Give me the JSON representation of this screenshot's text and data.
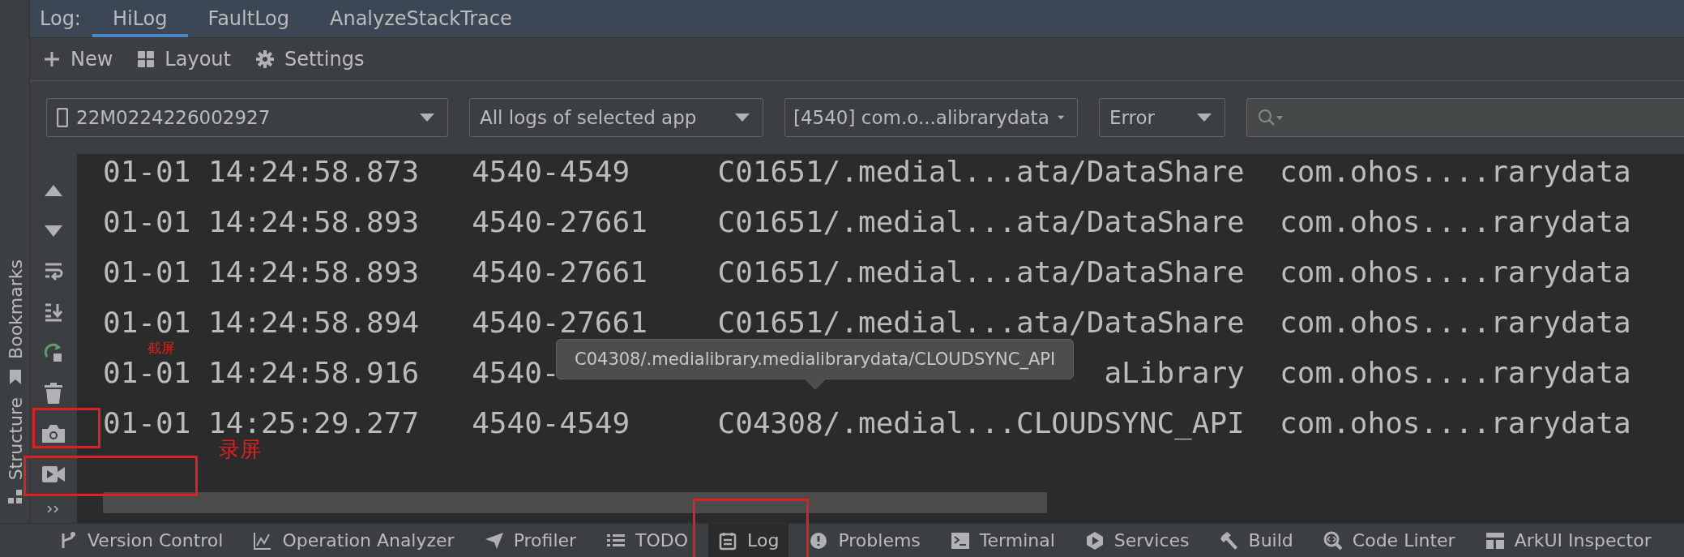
{
  "log_tabs": {
    "label": "Log:",
    "tabs": [
      {
        "label": "HiLog",
        "selected": true
      },
      {
        "label": "FaultLog",
        "selected": false
      },
      {
        "label": "AnalyzeStackTrace",
        "selected": false
      }
    ]
  },
  "toolbar": [
    {
      "label": "New"
    },
    {
      "label": "Layout"
    },
    {
      "label": "Settings"
    }
  ],
  "filters": {
    "device": "22M0224226002927",
    "scope": "All logs of selected app",
    "process": "[4540] com.o...alibrarydata",
    "level": "Error"
  },
  "side_strip": [
    {
      "label": "Bookmarks"
    },
    {
      "label": "Structure"
    }
  ],
  "log_rows": [
    {
      "time": "01-01 14:24:58.873",
      "pid": "4540-4549",
      "tag": "C01651/.medial...ata/DataShare",
      "package": "com.ohos....rarydata"
    },
    {
      "time": "01-01 14:24:58.893",
      "pid": "4540-27661",
      "tag": "C01651/.medial...ata/DataShare",
      "package": "com.ohos....rarydata"
    },
    {
      "time": "01-01 14:24:58.893",
      "pid": "4540-27661",
      "tag": "C01651/.medial...ata/DataShare",
      "package": "com.ohos....rarydata"
    },
    {
      "time": "01-01 14:24:58.894",
      "pid": "4540-27661",
      "tag": "C01651/.medial...ata/DataShare",
      "package": "com.ohos....rarydata"
    },
    {
      "time": "01-01 14:24:58.916",
      "pid": "4540-",
      "tag": "aLibrary",
      "package": "com.ohos....rarydata"
    },
    {
      "time": "01-01 14:25:29.277",
      "pid": "4540-4549",
      "tag": "C04308/.medial...CLOUDSYNC_API",
      "package": "com.ohos....rarydata"
    }
  ],
  "tooltip": {
    "text": "C04308/.medialibrary.medialibrarydata/CLOUDSYNC_API"
  },
  "annotations": [
    {
      "text": "截屏"
    },
    {
      "text": "录屏"
    }
  ],
  "tool_windows": [
    {
      "label": "Version Control",
      "selected": false
    },
    {
      "label": "Operation Analyzer",
      "selected": false
    },
    {
      "label": "Profiler",
      "selected": false
    },
    {
      "label": "TODO",
      "selected": false
    },
    {
      "label": "Log",
      "selected": true
    },
    {
      "label": "Problems",
      "selected": false
    },
    {
      "label": "Terminal",
      "selected": false
    },
    {
      "label": "Services",
      "selected": false
    },
    {
      "label": "Build",
      "selected": false
    },
    {
      "label": "Code Linter",
      "selected": false
    },
    {
      "label": "ArkUI Inspector",
      "selected": false
    }
  ]
}
